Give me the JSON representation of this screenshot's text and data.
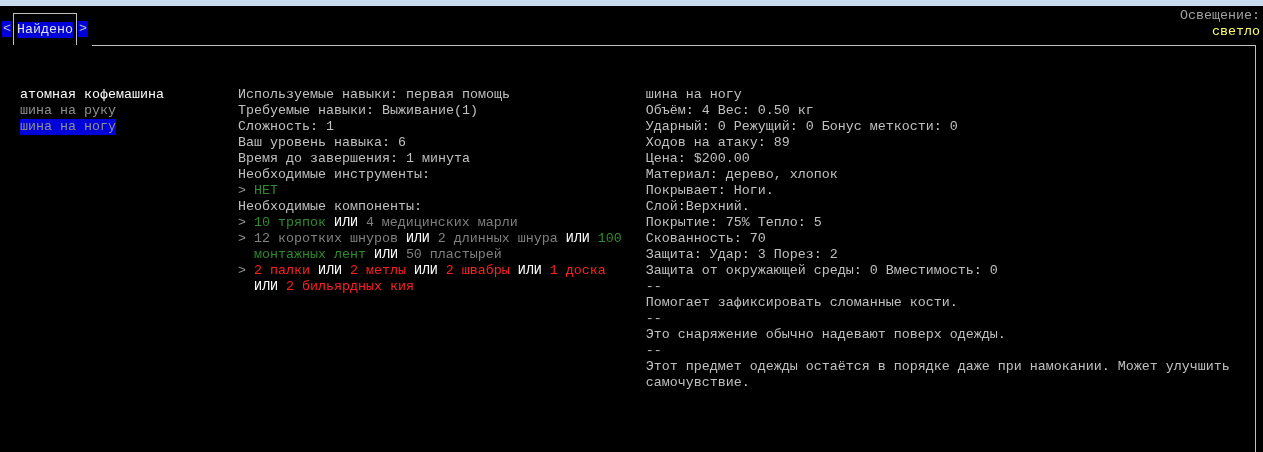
{
  "tab_bar": {
    "prev": "<",
    "next": ">",
    "tabs": [
      {
        "label": "Найдено",
        "selected": true
      }
    ]
  },
  "lighting": {
    "label": "Освещение:",
    "value": "светло"
  },
  "recipes": [
    {
      "label": "атомная кофемашина",
      "available": true,
      "selected": false
    },
    {
      "label": "шина на руку",
      "available": false,
      "selected": false
    },
    {
      "label": "шина на ногу",
      "available": false,
      "selected": true
    }
  ],
  "requirements": {
    "lines": [
      "Используемые навыки: первая помощь",
      "Требуемые навыки: Выживание(1)",
      "Сложность: 1",
      "Ваш уровень навыка: 6",
      "Время до завершения: 1 минута"
    ],
    "tools_title": "Необходимые инструменты:",
    "tools": [
      {
        "marker": ">",
        "lines": [
          [
            {
              "kind": "option",
              "text": "НЕТ",
              "color": "#2e8b2e"
            }
          ]
        ]
      }
    ],
    "components_title": "Необходимые компоненты:",
    "components": [
      {
        "marker": ">",
        "lines": [
          [
            {
              "kind": "option",
              "text": "10 тряпок",
              "color": "#2e8b2e"
            },
            {
              "kind": "or",
              "text": "ИЛИ"
            },
            {
              "kind": "option",
              "text": "4 медицинских марли",
              "color": "#808080"
            }
          ]
        ]
      },
      {
        "marker": ">",
        "lines": [
          [
            {
              "kind": "option",
              "text": "12 коротких шнуров",
              "color": "#808080"
            },
            {
              "kind": "or",
              "text": "ИЛИ"
            },
            {
              "kind": "option",
              "text": "2 длинных шнура",
              "color": "#808080"
            },
            {
              "kind": "or",
              "text": "ИЛИ"
            },
            {
              "kind": "option",
              "text": "100",
              "color": "#2e8b2e"
            }
          ],
          [
            {
              "kind": "option",
              "text": "монтажных лент",
              "color": "#2e8b2e"
            },
            {
              "kind": "or",
              "text": "ИЛИ"
            },
            {
              "kind": "option",
              "text": "50 пластырей",
              "color": "#808080"
            }
          ]
        ]
      },
      {
        "marker": ">",
        "lines": [
          [
            {
              "kind": "option",
              "text": "2 палки",
              "color": "#ff2020"
            },
            {
              "kind": "or",
              "text": "ИЛИ"
            },
            {
              "kind": "option",
              "text": "2 метлы",
              "color": "#ff2020"
            },
            {
              "kind": "or",
              "text": "ИЛИ"
            },
            {
              "kind": "option",
              "text": "2 швабры",
              "color": "#ff2020"
            },
            {
              "kind": "or",
              "text": "ИЛИ"
            },
            {
              "kind": "option",
              "text": "1 доска",
              "color": "#ff2020"
            }
          ],
          [
            {
              "kind": "or",
              "text": "ИЛИ"
            },
            {
              "kind": "option",
              "text": "2 бильярдных кия",
              "color": "#ff2020"
            }
          ]
        ]
      }
    ]
  },
  "item_info": [
    "шина на ногу",
    "Объём: 4 Вес: 0.50 кг",
    "Ударный: 0 Режущий: 0 Бонус меткости: 0",
    "Ходов на атаку: 89",
    "Цена: $200.00",
    "Материал: дерево, хлопок",
    "Покрывает: Ноги.",
    "Слой:Верхний.",
    "Покрытие: 75% Тепло: 5",
    "Скованность: 70",
    "Защита: Удар: 3 Порез: 2",
    "Защита от окружающей среды: 0 Вместимость: 0",
    "--",
    "Помогает зафиксировать сломанные кости.",
    "--",
    "Это снаряжение обычно надевают поверх одежды.",
    "--",
    "Этот предмет одежды остаётся в порядке даже при намокании. Может улучшить самочувствие."
  ]
}
